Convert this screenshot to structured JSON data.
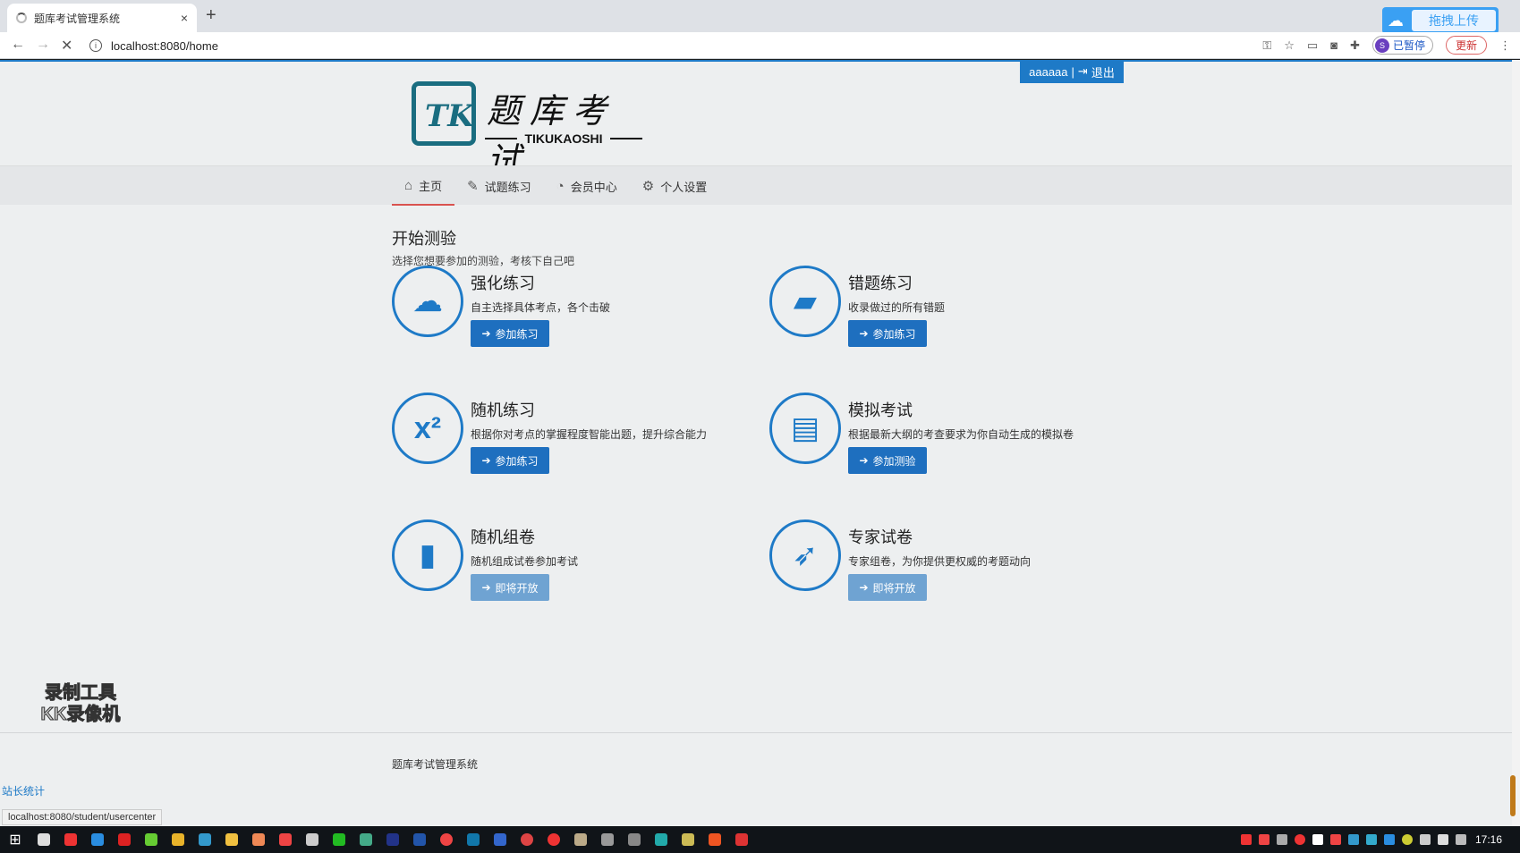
{
  "browser": {
    "tab_title": "题库考试管理系统",
    "tab_close": "×",
    "new_tab": "+",
    "url": "localhost:8080/home",
    "profile_initial": "S",
    "profile_label": "已暂停",
    "update_label": "更新",
    "upload_label": "拖拽上传"
  },
  "header": {
    "user": "aaaaaa",
    "separator": "|",
    "logout": "退出",
    "logo_cn": "题库考试",
    "logo_en": "TIKUKAOSHI",
    "logo_mark": "TK"
  },
  "nav": {
    "items": [
      {
        "label": "主页",
        "icon": "home-icon",
        "active": true
      },
      {
        "label": "试题练习",
        "icon": "edit-icon"
      },
      {
        "label": "会员中心",
        "icon": "dashboard-icon"
      },
      {
        "label": "个人设置",
        "icon": "gears-icon"
      }
    ]
  },
  "main": {
    "title": "开始测验",
    "subtitle": "选择您想要参加的测验，考核下自己吧",
    "cards": [
      {
        "title": "强化练习",
        "desc": "自主选择具体考点，各个击破",
        "button": "参加练习",
        "icon": "cloud-upload-icon"
      },
      {
        "title": "错题练习",
        "desc": "收录做过的所有错题",
        "button": "参加练习",
        "icon": "eraser-icon"
      },
      {
        "title": "随机练习",
        "desc": "根据你对考点的掌握程度智能出题，提升综合能力",
        "button": "参加练习",
        "icon": "superscript-icon"
      },
      {
        "title": "模拟考试",
        "desc": "根据最新大纲的考查要求为你自动生成的模拟卷",
        "button": "参加测验",
        "icon": "document-icon"
      },
      {
        "title": "随机组卷",
        "desc": "随机组成试卷参加考试",
        "button": "即将开放",
        "icon": "book-icon"
      },
      {
        "title": "专家试卷",
        "desc": "专家组卷，为你提供更权威的考题动向",
        "button": "即将开放",
        "icon": "rocket-icon"
      }
    ]
  },
  "watermark": {
    "line1": "录制工具",
    "line2": "KK录像机"
  },
  "footer": {
    "text": "题库考试管理系统",
    "stats_link": "站长统计",
    "status_url": "localhost:8080/student/usercenter"
  },
  "taskbar": {
    "time": "17:16"
  },
  "colors": {
    "primary": "#1e7ac7",
    "active_underline": "#d9534f",
    "logo": "#1a6d80"
  }
}
